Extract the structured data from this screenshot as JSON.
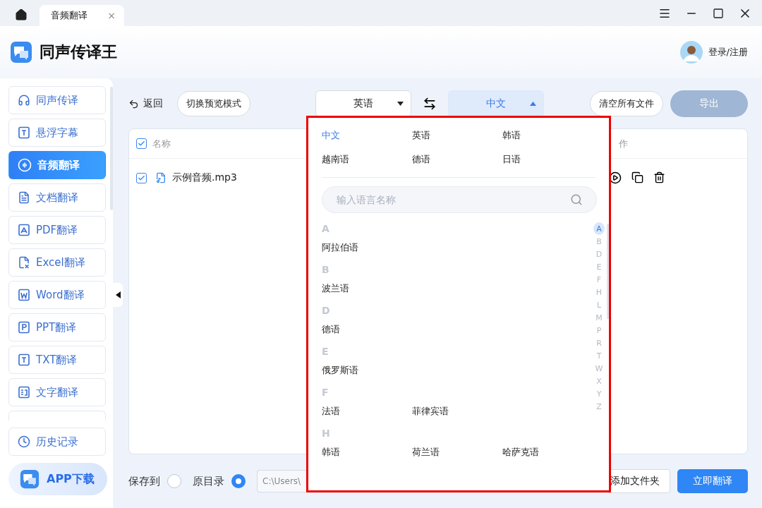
{
  "tabs": [
    {
      "label": "音频翻译",
      "close": "×",
      "selected": true
    }
  ],
  "app": {
    "title": "同声传译王",
    "login": "登录/注册"
  },
  "sidebar": {
    "items": [
      {
        "label": "同声传译",
        "kind": "headphones",
        "selected": false
      },
      {
        "label": "悬浮字幕",
        "kind": "t",
        "selected": false
      },
      {
        "label": "音频翻译",
        "kind": "audio",
        "selected": true
      },
      {
        "label": "文档翻译",
        "kind": "doc",
        "selected": false
      },
      {
        "label": "PDF翻译",
        "kind": "pdf",
        "selected": false
      },
      {
        "label": "Excel翻译",
        "kind": "excel",
        "selected": false
      },
      {
        "label": "Word翻译",
        "kind": "word",
        "selected": false
      },
      {
        "label": "PPT翻译",
        "kind": "ppt",
        "selected": false
      },
      {
        "label": "TXT翻译",
        "kind": "t",
        "selected": false
      },
      {
        "label": "文字翻译",
        "kind": "text",
        "selected": false
      }
    ],
    "history": "历史记录",
    "download": "APP下载"
  },
  "toolbar": {
    "back": "返回",
    "preview": "切换预览模式",
    "source": "英语",
    "target": "中文",
    "clear": "清空所有文件",
    "export": "导出"
  },
  "table": {
    "columns": [
      "名称",
      "作"
    ],
    "header_checked": true,
    "rows": [
      {
        "name": "示例音频.mp3",
        "checked": true
      }
    ]
  },
  "dropdown": {
    "recent": [
      {
        "label": "中文",
        "selected": true
      },
      {
        "label": "英语",
        "selected": false
      },
      {
        "label": "韩语",
        "selected": false
      },
      {
        "label": "越南语",
        "selected": false
      },
      {
        "label": "德语",
        "selected": false
      },
      {
        "label": "日语",
        "selected": false
      }
    ],
    "placeholder": "输入语言名称",
    "sections": [
      {
        "letter": "A",
        "languages": [
          "阿拉伯语"
        ]
      },
      {
        "letter": "B",
        "languages": [
          "波兰语"
        ]
      },
      {
        "letter": "D",
        "languages": [
          "德语"
        ]
      },
      {
        "letter": "E",
        "languages": [
          "俄罗斯语"
        ]
      },
      {
        "letter": "F",
        "languages": [
          "法语",
          "菲律宾语"
        ]
      },
      {
        "letter": "H",
        "languages": [
          "韩语",
          "荷兰语",
          "哈萨克语"
        ]
      }
    ],
    "index": [
      {
        "letter": "A",
        "selected": true
      },
      {
        "letter": "B",
        "selected": false
      },
      {
        "letter": "D",
        "selected": false
      },
      {
        "letter": "E",
        "selected": false
      },
      {
        "letter": "F",
        "selected": false
      },
      {
        "letter": "H",
        "selected": false
      },
      {
        "letter": "L",
        "selected": false
      },
      {
        "letter": "M",
        "selected": false
      },
      {
        "letter": "P",
        "selected": false
      },
      {
        "letter": "R",
        "selected": false
      },
      {
        "letter": "T",
        "selected": false
      },
      {
        "letter": "W",
        "selected": false
      },
      {
        "letter": "X",
        "selected": false
      },
      {
        "letter": "Y",
        "selected": false
      },
      {
        "letter": "Z",
        "selected": false
      }
    ]
  },
  "footer": {
    "save_to": "保存到",
    "original_dir": "原目录",
    "save_to_selected": false,
    "original_selected": true,
    "path": "C:\\Users\\",
    "add_folder": "添加文件夹",
    "translate": "立即翻译"
  }
}
